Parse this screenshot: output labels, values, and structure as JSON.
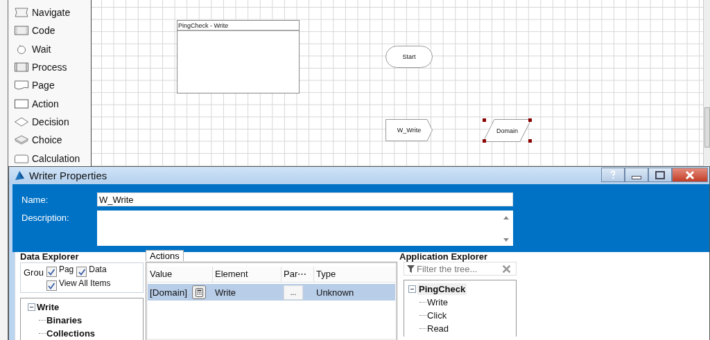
{
  "toolbox": {
    "items": [
      {
        "label": "Navigate",
        "kind": "navigate"
      },
      {
        "label": "Code",
        "kind": "code"
      },
      {
        "label": "Wait",
        "kind": "wait"
      },
      {
        "label": "Process",
        "kind": "process"
      },
      {
        "label": "Page",
        "kind": "page"
      },
      {
        "label": "Action",
        "kind": "action"
      },
      {
        "label": "Decision",
        "kind": "decision"
      },
      {
        "label": "Choice",
        "kind": "choice"
      },
      {
        "label": "Calculation",
        "kind": "calculation"
      }
    ]
  },
  "canvas": {
    "frame": {
      "title": "PingCheck - Write"
    },
    "nodes": [
      {
        "label": "Start",
        "kind": "terminator",
        "selected": false
      },
      {
        "label": "W_Write",
        "kind": "writer",
        "selected": false
      },
      {
        "label": "Domain",
        "kind": "data",
        "selected": true
      }
    ]
  },
  "dialog": {
    "title": "Writer Properties",
    "name_label": "Name:",
    "name_value": "W_Write",
    "description_label": "Description:"
  },
  "data_explorer": {
    "title": "Data Explorer",
    "group_label": "Grou",
    "options": [
      {
        "label": "Pag",
        "checked": true
      },
      {
        "label": "Data",
        "checked": true
      },
      {
        "label": "View All Items",
        "checked": true
      }
    ],
    "tree": {
      "label": "Write",
      "expanded": true,
      "selected": false,
      "children": [
        {
          "label": "Binaries",
          "selected": false
        },
        {
          "label": "Collections",
          "selected": false
        }
      ]
    }
  },
  "actions": {
    "tabs": [
      {
        "label": "Actions",
        "selected": true
      }
    ],
    "columns": [
      "Value",
      "Element",
      "Par⋯",
      "Type"
    ],
    "rows": [
      {
        "value": "[Domain]",
        "element": "Write",
        "parameter": "...",
        "type": "Unknown",
        "selected": true
      }
    ]
  },
  "application_explorer": {
    "title": "Application Explorer",
    "filter": {
      "placeholder": "Filter the tree..."
    },
    "tree": {
      "label": "PingCheck",
      "expanded": true,
      "selected": true,
      "children": [
        {
          "label": "Write",
          "selected": false
        },
        {
          "label": "Click",
          "selected": false
        },
        {
          "label": "Read",
          "selected": false
        }
      ]
    }
  }
}
